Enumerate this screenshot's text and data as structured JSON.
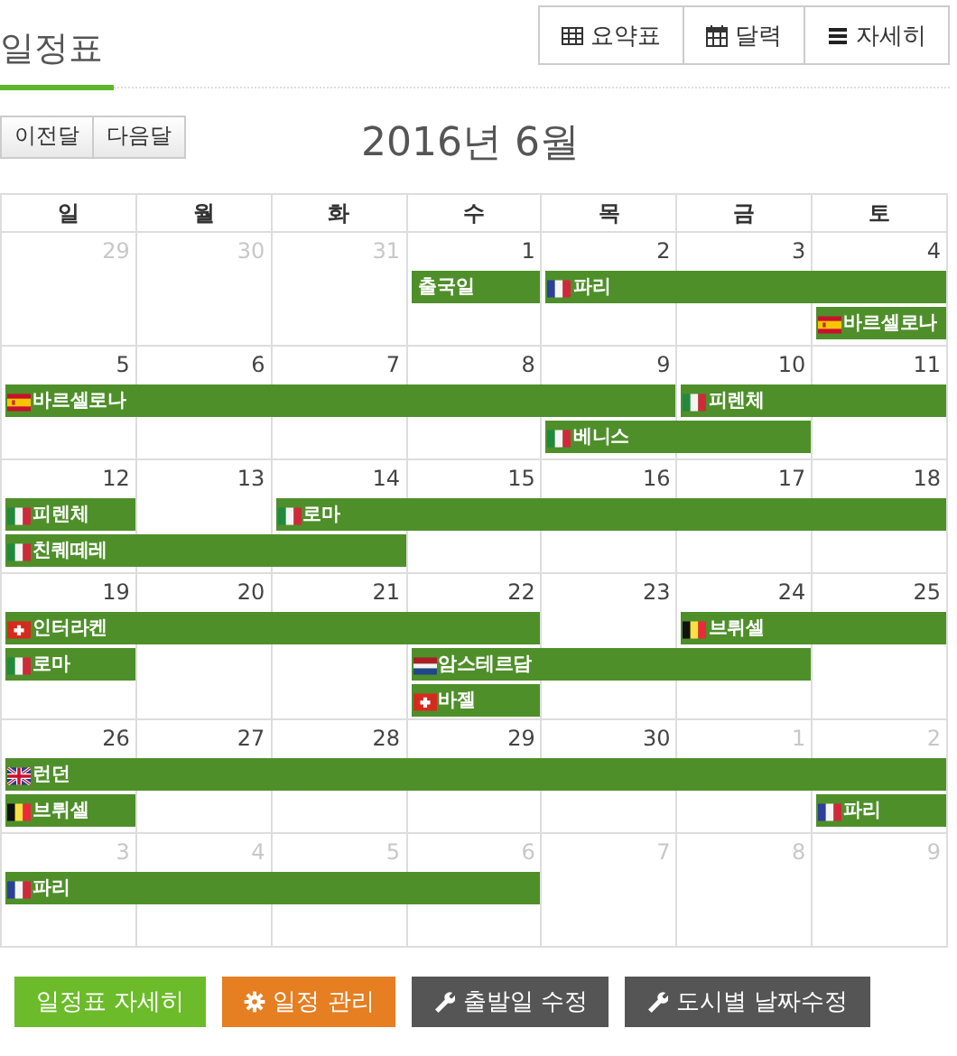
{
  "page_title": "일정표",
  "view_buttons": [
    {
      "kind": "table",
      "label": "요약표"
    },
    {
      "kind": "calendar",
      "label": "달력"
    },
    {
      "kind": "list",
      "label": "자세히"
    }
  ],
  "nav_buttons": [
    "이전달",
    "다음달"
  ],
  "month_title": "2016년 6월",
  "weekdays": [
    "일",
    "월",
    "화",
    "수",
    "목",
    "금",
    "토"
  ],
  "weeks": [
    {
      "days": [
        {
          "label": "29",
          "other": true
        },
        {
          "label": "30",
          "other": true
        },
        {
          "label": "31",
          "other": true
        },
        {
          "label": "1",
          "other": false
        },
        {
          "label": "2",
          "other": false
        },
        {
          "label": "3",
          "other": false
        },
        {
          "label": "4",
          "other": false
        }
      ],
      "lanes": [
        [
          {
            "kind": "empty"
          },
          {
            "kind": "empty"
          },
          {
            "kind": "empty"
          },
          {
            "kind": "plain",
            "label": "출국일"
          },
          {
            "kind": "fr",
            "label": "파리"
          },
          {
            "kind": "cont"
          },
          {
            "kind": "cont"
          }
        ],
        [
          {
            "kind": "empty"
          },
          {
            "kind": "empty"
          },
          {
            "kind": "empty"
          },
          {
            "kind": "empty"
          },
          {
            "kind": "empty"
          },
          {
            "kind": "empty"
          },
          {
            "kind": "es",
            "label": "바르셀로나"
          }
        ]
      ]
    },
    {
      "days": [
        {
          "label": "5",
          "other": false
        },
        {
          "label": "6",
          "other": false
        },
        {
          "label": "7",
          "other": false
        },
        {
          "label": "8",
          "other": false
        },
        {
          "label": "9",
          "other": false
        },
        {
          "label": "10",
          "other": false
        },
        {
          "label": "11",
          "other": false
        }
      ],
      "lanes": [
        [
          {
            "kind": "es",
            "label": "바르셀로나"
          },
          {
            "kind": "cont"
          },
          {
            "kind": "cont"
          },
          {
            "kind": "cont"
          },
          {
            "kind": "cont"
          },
          {
            "kind": "it",
            "label": "피렌체"
          },
          {
            "kind": "cont"
          }
        ],
        [
          {
            "kind": "empty"
          },
          {
            "kind": "empty"
          },
          {
            "kind": "empty"
          },
          {
            "kind": "empty"
          },
          {
            "kind": "it",
            "label": "베니스"
          },
          {
            "kind": "cont"
          },
          {
            "kind": "empty"
          }
        ]
      ]
    },
    {
      "days": [
        {
          "label": "12",
          "other": false
        },
        {
          "label": "13",
          "other": false
        },
        {
          "label": "14",
          "other": false
        },
        {
          "label": "15",
          "other": false
        },
        {
          "label": "16",
          "other": false
        },
        {
          "label": "17",
          "other": false
        },
        {
          "label": "18",
          "other": false
        }
      ],
      "lanes": [
        [
          {
            "kind": "it",
            "label": "피렌체"
          },
          {
            "kind": "empty"
          },
          {
            "kind": "it",
            "label": "로마"
          },
          {
            "kind": "cont"
          },
          {
            "kind": "cont"
          },
          {
            "kind": "cont"
          },
          {
            "kind": "cont"
          }
        ],
        [
          {
            "kind": "it",
            "label": "친퀘떼레"
          },
          {
            "kind": "cont"
          },
          {
            "kind": "cont"
          },
          {
            "kind": "empty"
          },
          {
            "kind": "empty"
          },
          {
            "kind": "empty"
          },
          {
            "kind": "empty"
          }
        ]
      ]
    },
    {
      "days": [
        {
          "label": "19",
          "other": false
        },
        {
          "label": "20",
          "other": false
        },
        {
          "label": "21",
          "other": false
        },
        {
          "label": "22",
          "other": false
        },
        {
          "label": "23",
          "other": false
        },
        {
          "label": "24",
          "other": false
        },
        {
          "label": "25",
          "other": false
        }
      ],
      "lanes": [
        [
          {
            "kind": "ch",
            "label": "인터라켄"
          },
          {
            "kind": "cont"
          },
          {
            "kind": "cont"
          },
          {
            "kind": "cont"
          },
          {
            "kind": "empty"
          },
          {
            "kind": "be",
            "label": "브뤼셀"
          },
          {
            "kind": "cont"
          }
        ],
        [
          {
            "kind": "it",
            "label": "로마"
          },
          {
            "kind": "empty"
          },
          {
            "kind": "empty"
          },
          {
            "kind": "nl",
            "label": "암스테르담"
          },
          {
            "kind": "cont"
          },
          {
            "kind": "cont"
          },
          {
            "kind": "empty"
          }
        ],
        [
          {
            "kind": "empty"
          },
          {
            "kind": "empty"
          },
          {
            "kind": "empty"
          },
          {
            "kind": "ch",
            "label": "바젤"
          },
          {
            "kind": "empty"
          },
          {
            "kind": "empty"
          },
          {
            "kind": "empty"
          }
        ]
      ]
    },
    {
      "days": [
        {
          "label": "26",
          "other": false
        },
        {
          "label": "27",
          "other": false
        },
        {
          "label": "28",
          "other": false
        },
        {
          "label": "29",
          "other": false
        },
        {
          "label": "30",
          "other": false
        },
        {
          "label": "1",
          "other": true
        },
        {
          "label": "2",
          "other": true
        }
      ],
      "lanes": [
        [
          {
            "kind": "gb",
            "label": "런던"
          },
          {
            "kind": "cont"
          },
          {
            "kind": "cont"
          },
          {
            "kind": "cont"
          },
          {
            "kind": "cont"
          },
          {
            "kind": "cont"
          },
          {
            "kind": "cont"
          }
        ],
        [
          {
            "kind": "be",
            "label": "브뤼셀"
          },
          {
            "kind": "empty"
          },
          {
            "kind": "empty"
          },
          {
            "kind": "empty"
          },
          {
            "kind": "empty"
          },
          {
            "kind": "empty"
          },
          {
            "kind": "fr",
            "label": "파리"
          }
        ]
      ]
    },
    {
      "days": [
        {
          "label": "3",
          "other": true
        },
        {
          "label": "4",
          "other": true
        },
        {
          "label": "5",
          "other": true
        },
        {
          "label": "6",
          "other": true
        },
        {
          "label": "7",
          "other": true
        },
        {
          "label": "8",
          "other": true
        },
        {
          "label": "9",
          "other": true
        }
      ],
      "lanes": [
        [
          {
            "kind": "fr",
            "label": "파리"
          },
          {
            "kind": "cont"
          },
          {
            "kind": "cont"
          },
          {
            "kind": "cont"
          },
          {
            "kind": "empty"
          },
          {
            "kind": "empty"
          },
          {
            "kind": "empty"
          }
        ]
      ]
    }
  ],
  "action_buttons": [
    {
      "kind": "primary",
      "label": "일정표 자세히"
    },
    {
      "kind": "manage",
      "label": "일정 관리"
    },
    {
      "kind": "edit",
      "label": "출발일 수정"
    },
    {
      "kind": "edit",
      "label": "도시별 날짜수정"
    }
  ]
}
